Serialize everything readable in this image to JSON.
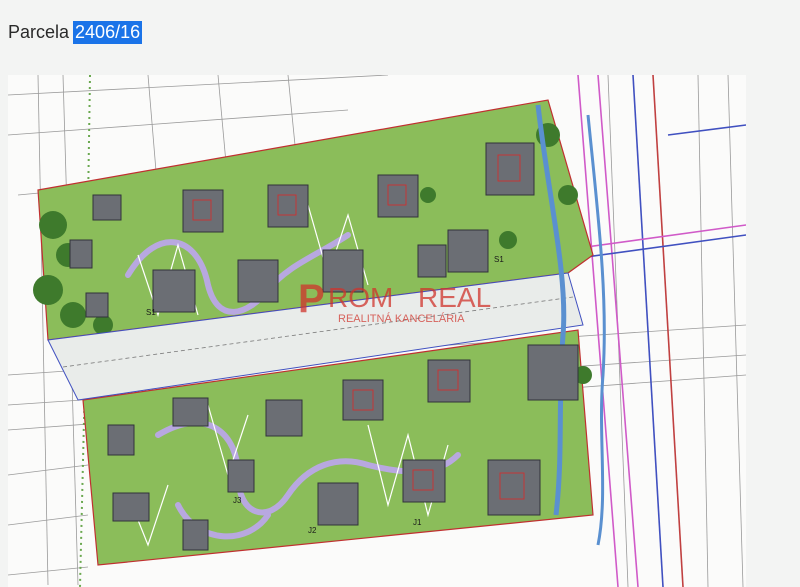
{
  "header": {
    "prefix": "Parcela",
    "parcel_number": "2406/16"
  },
  "watermark": {
    "brand_part1": "P",
    "brand_part2": "ROM",
    "brand_part3": "REAL",
    "subtitle": "REALITNÁ KANCELÁRIA"
  },
  "plan": {
    "zone_labels": [
      "S1",
      "S1",
      "J1",
      "J2",
      "J3"
    ]
  },
  "colors": {
    "highlight": "#1a73e8",
    "green_area": "#7fb050",
    "path": "#b8a8e0",
    "house": "#6b6e74",
    "water": "#5a90d0",
    "watermark": "#d0342c"
  }
}
